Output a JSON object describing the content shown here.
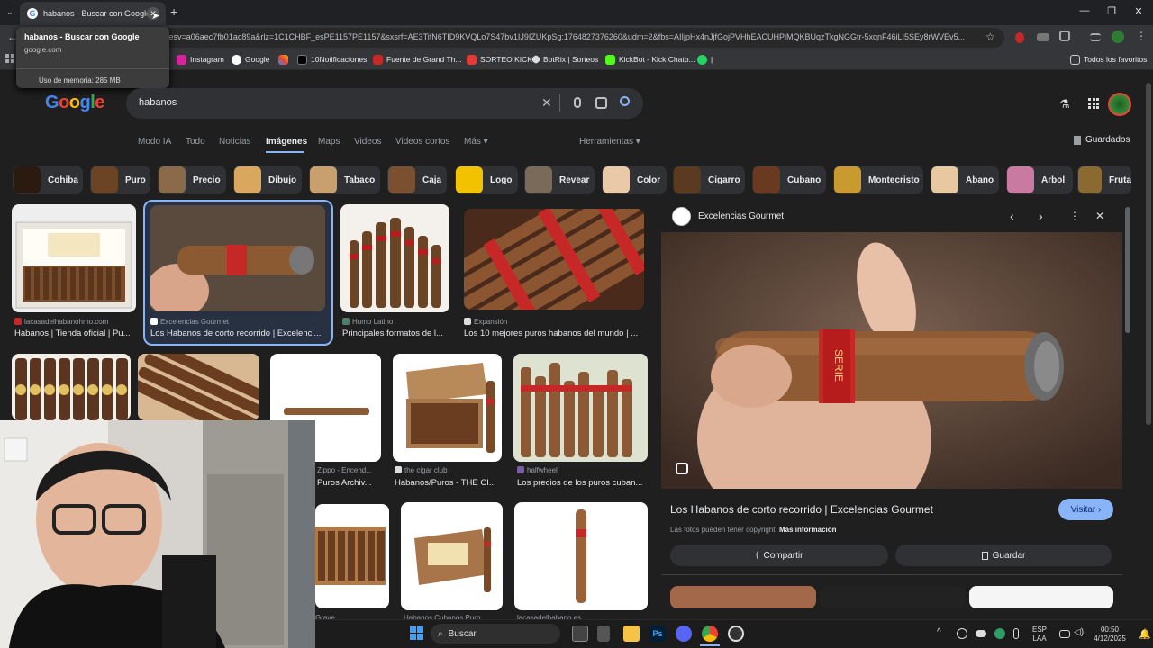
{
  "browser": {
    "tab_title": "habanos - Buscar con Google",
    "url": "ca_esv=a06aec7fb01ac89a&rlz=1C1CHBF_esPE1157PE1157&sxsrf=AE3TifN6TID9KVQLo7S47bv1IJ9IZUKpSg:1764827376260&udm=2&fbs=AIIjpHx4nJjfGojPVHhEACUHPiMQKBUqzTkgNGGtr-5xqnF46iLI5SEy8rWVEv5...",
    "tooltip": {
      "title": "habanos - Buscar con Google",
      "domain": "google.com",
      "memory": "Uso de memoria: 285 MB"
    },
    "bookmarks": [
      "Instagram",
      "Google",
      "",
      "10Notificaciones",
      "Fuente de Grand Th...",
      "SORTEO KICK",
      "BotRix | Sorteos",
      "KickBot - Kick Chatb...",
      "|"
    ],
    "all_favorites": "Todos los favoritos"
  },
  "google": {
    "logo": "Google",
    "query": "habanos",
    "nav": [
      "Modo IA",
      "Todo",
      "Noticias",
      "Imágenes",
      "Maps",
      "Videos",
      "Videos cortos",
      "Más ▾"
    ],
    "tools": "Herramientas ▾",
    "saved": "Guardados",
    "chips": [
      "Cohiba",
      "Puro",
      "Precio",
      "Dibujo",
      "Tabaco",
      "Caja",
      "Logo",
      "Revear",
      "Color",
      "Cigarro",
      "Cubano",
      "Montecristo",
      "Abano",
      "Arbol",
      "Fruta"
    ]
  },
  "results": [
    {
      "source": "lacasadelhabanohmo.com",
      "title": "Habanos | Tienda oficial | Pu..."
    },
    {
      "source": "Excelencias Gourmet",
      "title": "Los Habanos de corto recorrido | Excelenci..."
    },
    {
      "source": "Humo Latino",
      "title": "Principales formatos de l..."
    },
    {
      "source": "Expansión",
      "title": "Los 10 mejores puros habanos del mundo | ..."
    },
    {
      "source": "Zippo - Encend...",
      "title": "Puros Archiv..."
    },
    {
      "source": "the cigar club",
      "title": "Habanos/Puros - THE CI..."
    },
    {
      "source": "halfwheel",
      "title": "Los precios de los puros cuban..."
    },
    {
      "source": "Grave",
      "title": ""
    },
    {
      "source": "Habanos Cubanos Puro...",
      "title": ""
    },
    {
      "source": "lacasadelhabano.es",
      "title": ""
    }
  ],
  "panel": {
    "site": "Excelencias Gourmet",
    "title": "Los Habanos de corto recorrido | Excelencias Gourmet",
    "visit": "Visitar",
    "copyright": "Las fotos pueden tener copyright.",
    "more_info": "Más información",
    "share": "Compartir",
    "save": "Guardar",
    "band_text": "SERIE"
  },
  "taskbar": {
    "search": "Buscar",
    "lang1": "ESP",
    "lang2": "LAA",
    "time": "00:50",
    "date": "4/12/2025"
  }
}
